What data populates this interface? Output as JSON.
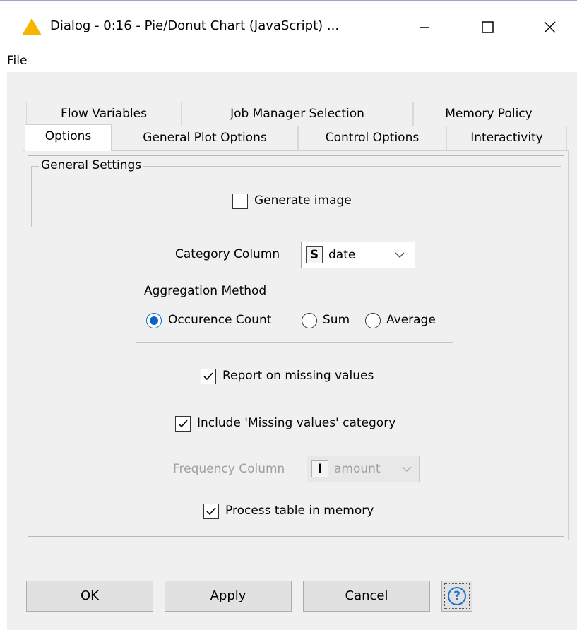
{
  "window": {
    "title": "Dialog - 0:16 - Pie/Donut Chart (JavaScript) ...",
    "warning_color": "#f7b500"
  },
  "menu": {
    "file": "File"
  },
  "tabs": {
    "row1": [
      "Flow Variables",
      "Job Manager Selection",
      "Memory Policy"
    ],
    "row2": [
      "Options",
      "General Plot Options",
      "Control Options",
      "Interactivity"
    ],
    "active": "Options"
  },
  "general_settings": {
    "legend": "General Settings",
    "generate_image": {
      "label": "Generate image",
      "checked": false
    }
  },
  "category_column": {
    "label": "Category Column",
    "type_badge": "S",
    "value": "date"
  },
  "aggregation": {
    "legend": "Aggregation Method",
    "options": [
      "Occurence Count",
      "Sum",
      "Average"
    ],
    "selected": "Occurence Count"
  },
  "report_missing": {
    "label": "Report on missing values",
    "checked": true
  },
  "include_missing": {
    "label": "Include 'Missing values' category",
    "checked": true
  },
  "frequency_column": {
    "label": "Frequency Column",
    "type_badge": "I",
    "value": "amount",
    "enabled": false
  },
  "process_in_memory": {
    "label": "Process table in memory",
    "checked": true
  },
  "buttons": {
    "ok": "OK",
    "apply": "Apply",
    "cancel": "Cancel",
    "help": "?"
  },
  "colors": {
    "accent": "#0a64c8",
    "help": "#1e73d2"
  }
}
